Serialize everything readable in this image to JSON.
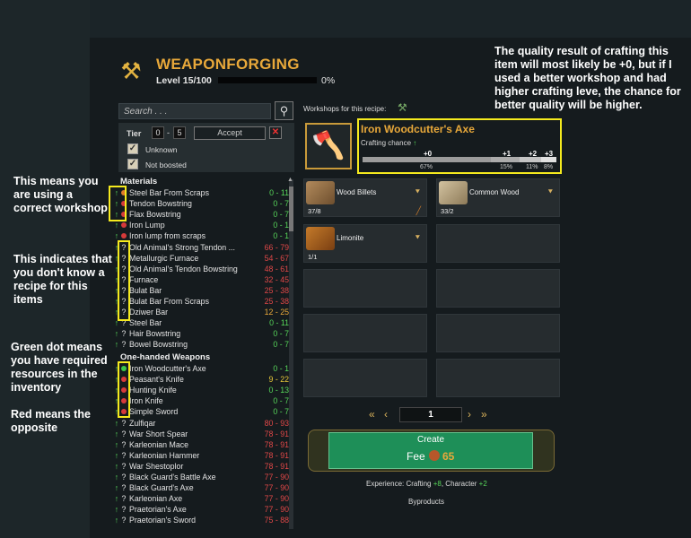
{
  "header": {
    "title": "WEAPONFORGING",
    "level": "Level 15/100",
    "progress": 0,
    "progress_label": "0%"
  },
  "search": {
    "placeholder": "Search . . ."
  },
  "filter": {
    "tier_label": "Tier",
    "tier_min": "0",
    "tier_max": "5",
    "accept_label": "Accept",
    "unknown_label": "Unknown",
    "not_boosted_label": "Not boosted"
  },
  "categories": {
    "materials": "Materials",
    "one_handed": "One-handed Weapons"
  },
  "materials": [
    {
      "mark": "up",
      "status": "orange",
      "name": "Steel Bar From Scraps",
      "range": "0 - 11",
      "color": "#57d65a"
    },
    {
      "mark": "up",
      "status": "red",
      "name": "Tendon Bowstring",
      "range": "0 - 7",
      "color": "#57d65a"
    },
    {
      "mark": "up",
      "status": "red",
      "name": "Flax Bowstring",
      "range": "0 - 7",
      "color": "#57d65a"
    },
    {
      "mark": "up",
      "status": "red",
      "name": "Iron Lump",
      "range": "0 - 1",
      "color": "#57d65a"
    },
    {
      "mark": "up",
      "status": "red",
      "name": "Iron lump from scraps",
      "range": "0 - 1",
      "color": "#57d65a"
    },
    {
      "mark": "up",
      "status": "q",
      "name": "Old Animal's Strong Tendon ...",
      "range": "66 - 79",
      "color": "#e04848"
    },
    {
      "mark": "up",
      "status": "q",
      "name": "Metallurgic Furnace",
      "range": "54 - 67",
      "color": "#e04848"
    },
    {
      "mark": "up",
      "status": "q",
      "name": "Old Animal's Tendon Bowstring",
      "range": "48 - 61",
      "color": "#e04848"
    },
    {
      "mark": "up",
      "status": "q",
      "name": "Furnace",
      "range": "32 - 45",
      "color": "#e04848"
    },
    {
      "mark": "up",
      "status": "q",
      "name": "Bulat Bar",
      "range": "25 - 38",
      "color": "#e04848"
    },
    {
      "mark": "up",
      "status": "q",
      "name": "Bulat Bar From Scraps",
      "range": "25 - 38",
      "color": "#e04848"
    },
    {
      "mark": "up",
      "status": "q",
      "name": "Dziwer Bar",
      "range": "12 - 25",
      "color": "#e8a83a"
    },
    {
      "mark": "up",
      "status": "q",
      "name": "Steel Bar",
      "range": "0 - 11",
      "color": "#57d65a"
    },
    {
      "mark": "up",
      "status": "q",
      "name": "Hair Bowstring",
      "range": "0 - 7",
      "color": "#57d65a"
    },
    {
      "mark": "up",
      "status": "q",
      "name": "Bowel Bowstring",
      "range": "0 - 7",
      "color": "#57d65a"
    }
  ],
  "weapons": [
    {
      "mark": "up",
      "status": "green",
      "name": "Iron Woodcutter's Axe",
      "range": "0 - 1",
      "color": "#57d65a"
    },
    {
      "mark": "up",
      "status": "red",
      "name": "Peasant's Knife",
      "range": "9 - 22",
      "color": "#e8c83a"
    },
    {
      "mark": "up",
      "status": "red",
      "name": "Hunting Knife",
      "range": "0 - 13",
      "color": "#57d65a"
    },
    {
      "mark": "up",
      "status": "red",
      "name": "Iron Knife",
      "range": "0 - 7",
      "color": "#57d65a"
    },
    {
      "mark": "up",
      "status": "red",
      "name": "Simple Sword",
      "range": "0 - 7",
      "color": "#57d65a"
    },
    {
      "mark": "up",
      "status": "q",
      "name": "Zulfiqar",
      "range": "80 - 93",
      "color": "#e04848"
    },
    {
      "mark": "up",
      "status": "q",
      "name": "War Short Spear",
      "range": "78 - 91",
      "color": "#e04848"
    },
    {
      "mark": "up",
      "status": "q",
      "name": "Karleonian Mace",
      "range": "78 - 91",
      "color": "#e04848"
    },
    {
      "mark": "up",
      "status": "q",
      "name": "Karleonian Hammer",
      "range": "78 - 91",
      "color": "#e04848"
    },
    {
      "mark": "up",
      "status": "q",
      "name": "War Shestoplor",
      "range": "78 - 91",
      "color": "#e04848"
    },
    {
      "mark": "up",
      "status": "q",
      "name": "Black Guard's Battle Axe",
      "range": "77 - 90",
      "color": "#e04848"
    },
    {
      "mark": "up",
      "status": "q",
      "name": "Black Guard's Axe",
      "range": "77 - 90",
      "color": "#e04848"
    },
    {
      "mark": "up",
      "status": "q",
      "name": "Karleonian Axe",
      "range": "77 - 90",
      "color": "#e04848"
    },
    {
      "mark": "up",
      "status": "q",
      "name": "Praetorian's Axe",
      "range": "77 - 90",
      "color": "#e04848"
    },
    {
      "mark": "up",
      "status": "q",
      "name": "Praetorian's Sword",
      "range": "75 - 88",
      "color": "#e04848"
    }
  ],
  "recipe": {
    "workshops_label": "Workshops for this recipe:",
    "item_name": "Iron Woodcutter's Axe",
    "crafting_chance_label": "Crafting chance",
    "quality": [
      {
        "label": "+0",
        "pct": "67%",
        "value": 67
      },
      {
        "label": "+1",
        "pct": "15%",
        "value": 15
      },
      {
        "label": "+2",
        "pct": "11%",
        "value": 11
      },
      {
        "label": "+3",
        "pct": "8%",
        "value": 8
      }
    ]
  },
  "resources": [
    {
      "name": "Wood Billets",
      "count": "37/8"
    },
    {
      "name": "Common Wood",
      "count": "33/2"
    },
    {
      "name": "Limonite",
      "count": "1/1"
    }
  ],
  "pagination": {
    "page": "1"
  },
  "create": {
    "label": "Create",
    "fee_label": "Fee",
    "fee_value": "65"
  },
  "experience": {
    "prefix": "Experience: Crafting",
    "crafting": "+8",
    "mid": ", Character",
    "character": "+2"
  },
  "byproducts_label": "Byproducts",
  "annotations": {
    "top": "The quality result of crafting this item will most likely be +0, but if I used a better workshop and had higher crafting leve, the chance for better quality will be higher.",
    "workshop": "This means you are using a correct workshop",
    "recipe": "This indicates that you don't know a recipe for this items",
    "green": "Green dot means you have required resources in the inventory",
    "red": "Red means the opposite"
  }
}
